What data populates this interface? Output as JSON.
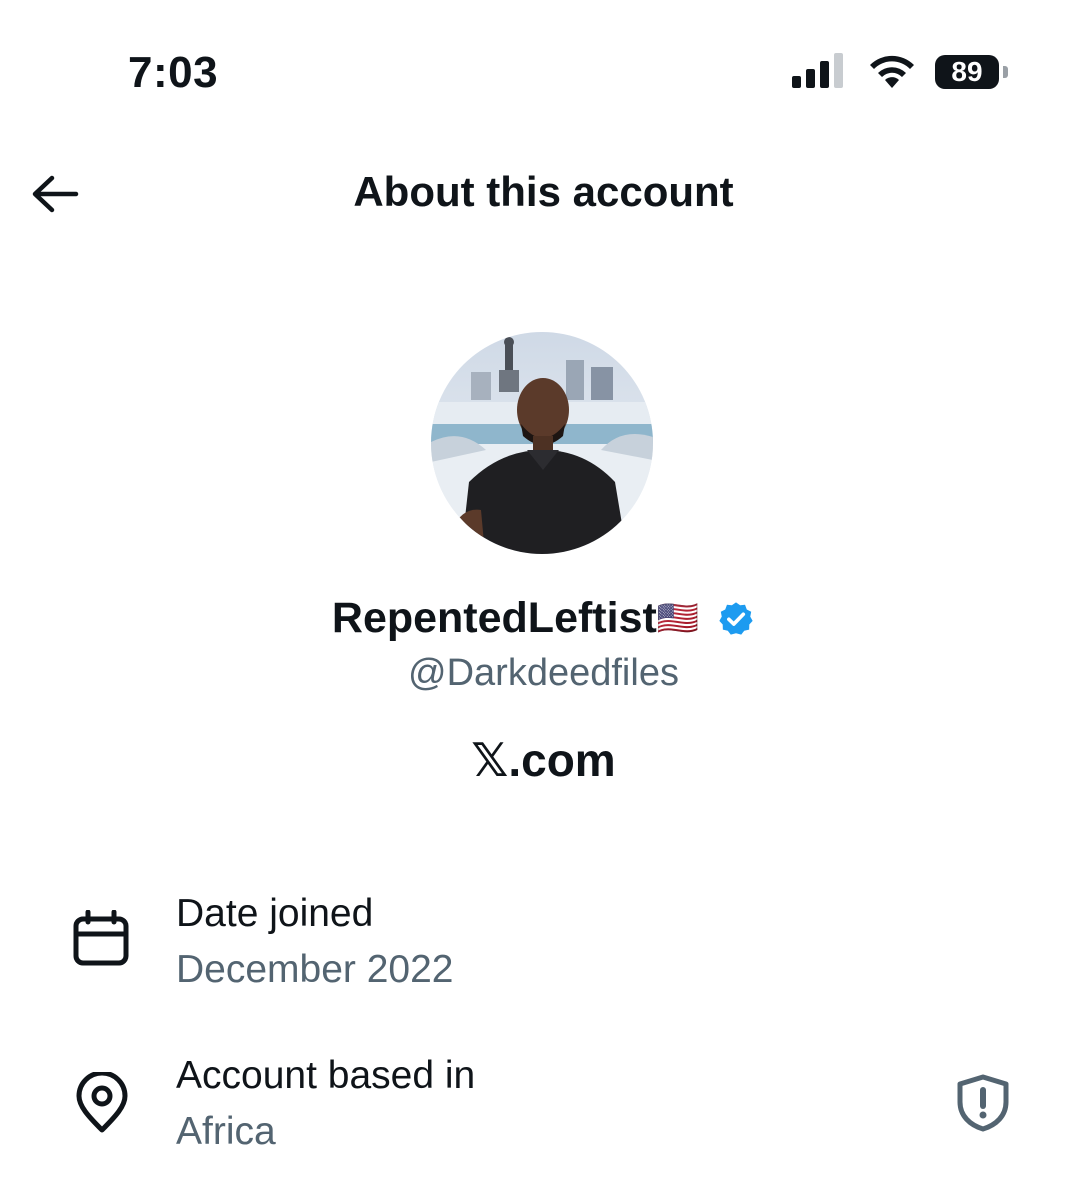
{
  "status_bar": {
    "time": "7:03",
    "battery": "89"
  },
  "header": {
    "title": "About this account",
    "back_icon": "arrow-left-icon"
  },
  "profile": {
    "display_name": "RepentedLeftist",
    "flag": "🇺🇸",
    "verified_icon": "verified-badge-icon",
    "handle": "@Darkdeedfiles",
    "platform": ".com",
    "platform_logo": "𝕏"
  },
  "details": [
    {
      "icon": "calendar-icon",
      "label": "Date joined",
      "value": "December 2022"
    },
    {
      "icon": "location-pin-icon",
      "label": "Account based in",
      "value": "Africa",
      "trailing_icon": "shield-alert-icon"
    }
  ],
  "colors": {
    "text": "#0f1419",
    "secondary": "#536471",
    "verified": "#1d9bf0"
  }
}
